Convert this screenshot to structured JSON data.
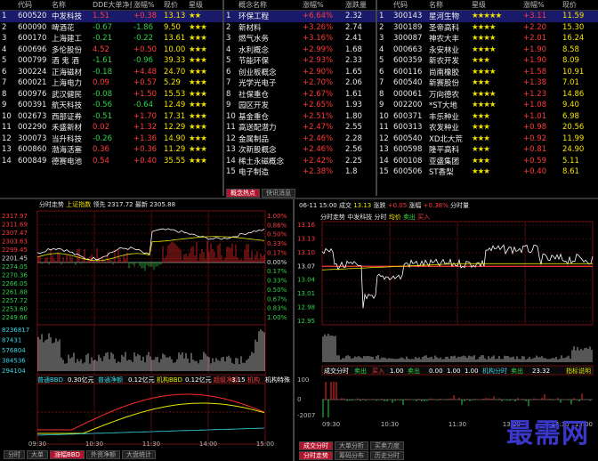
{
  "left_table": {
    "headers": [
      "代码",
      "名称",
      "DDE大单净量",
      "涨幅%",
      "现价",
      "星级"
    ],
    "rows": [
      {
        "idx": "1",
        "code": "600520",
        "name": "中发科技",
        "dde": "1.51",
        "chg": "+0.38",
        "price": "13.13",
        "stars": "★★",
        "sel": true
      },
      {
        "idx": "2",
        "code": "600090",
        "name": "啤酒花",
        "dde": "-0.67",
        "chg": "-1.86",
        "price": "9.50",
        "stars": "★★★"
      },
      {
        "idx": "3",
        "code": "600170",
        "name": "上海建工",
        "dde": "-0.21",
        "chg": "-0.22",
        "price": "13.61",
        "stars": "★★★"
      },
      {
        "idx": "4",
        "code": "600696",
        "name": "多伦股份",
        "dde": "4.52",
        "chg": "+0.50",
        "price": "10.00",
        "stars": "★★★"
      },
      {
        "idx": "5",
        "code": "000799",
        "name": "酒 鬼 酒",
        "dde": "-1.61",
        "chg": "-0.96",
        "price": "39.33",
        "stars": "★★★"
      },
      {
        "idx": "6",
        "code": "300224",
        "name": "正海磁材",
        "dde": "-0.18",
        "chg": "+4.48",
        "price": "24.70",
        "stars": "★★★"
      },
      {
        "idx": "7",
        "code": "600021",
        "name": "上海电力",
        "dde": "0.09",
        "chg": "+0.57",
        "price": "5.29",
        "stars": "★★★"
      },
      {
        "idx": "8",
        "code": "600976",
        "name": "武汉健民",
        "dde": "-0.08",
        "chg": "+1.50",
        "price": "15.53",
        "stars": "★★★"
      },
      {
        "idx": "9",
        "code": "600391",
        "name": "航天科技",
        "dde": "-0.56",
        "chg": "-0.64",
        "price": "12.49",
        "stars": "★★★"
      },
      {
        "idx": "10",
        "code": "002673",
        "name": "西部证券",
        "dde": "-0.51",
        "chg": "+1.70",
        "price": "17.31",
        "stars": "★★★"
      },
      {
        "idx": "11",
        "code": "002290",
        "name": "禾盛新材",
        "dde": "0.02",
        "chg": "+1.32",
        "price": "12.29",
        "stars": "★★★"
      },
      {
        "idx": "12",
        "code": "300073",
        "name": "当升科技",
        "dde": "-0.26",
        "chg": "+1.36",
        "price": "14.90",
        "stars": "★★★"
      },
      {
        "idx": "13",
        "code": "600860",
        "name": "渤海活塞",
        "dde": "0.36",
        "chg": "+0.36",
        "price": "11.29",
        "stars": "★★★"
      },
      {
        "idx": "14",
        "code": "600849",
        "name": "德赛电池",
        "dde": "0.54",
        "chg": "+0.40",
        "price": "35.55",
        "stars": "★★★"
      }
    ]
  },
  "concept_table": {
    "headers": [
      "",
      "概念名称",
      "涨幅%",
      "涨跌量"
    ],
    "rows": [
      {
        "idx": "1",
        "name": "环保工程",
        "chg": "+6.64%",
        "vol": "2.32",
        "sel": true
      },
      {
        "idx": "2",
        "name": "新材料",
        "chg": "+3.26%",
        "vol": "2.74"
      },
      {
        "idx": "3",
        "name": "燃气水务",
        "chg": "+3.16%",
        "vol": "2.41"
      },
      {
        "idx": "4",
        "name": "水利概念",
        "chg": "+2.99%",
        "vol": "1.68"
      },
      {
        "idx": "5",
        "name": "节能环保",
        "chg": "+2.93%",
        "vol": "2.33"
      },
      {
        "idx": "6",
        "name": "创业板概念",
        "chg": "+2.90%",
        "vol": "1.65"
      },
      {
        "idx": "7",
        "name": "光学光电子",
        "chg": "+2.70%",
        "vol": "2.06"
      },
      {
        "idx": "8",
        "name": "社保重仓",
        "chg": "+2.67%",
        "vol": "1.61"
      },
      {
        "idx": "9",
        "name": "园区开发",
        "chg": "+2.65%",
        "vol": "1.93"
      },
      {
        "idx": "10",
        "name": "基金重仓",
        "chg": "+2.51%",
        "vol": "1.80"
      },
      {
        "idx": "11",
        "name": "高送配潜力",
        "chg": "+2.47%",
        "vol": "2.55"
      },
      {
        "idx": "12",
        "name": "金属制品",
        "chg": "+2.46%",
        "vol": "2.28"
      },
      {
        "idx": "13",
        "name": "次新股概念",
        "chg": "+2.46%",
        "vol": "2.56"
      },
      {
        "idx": "14",
        "name": "稀土永磁概念",
        "chg": "+2.42%",
        "vol": "2.25"
      },
      {
        "idx": "15",
        "name": "电子制造",
        "chg": "+2.38%",
        "vol": "1.8"
      }
    ]
  },
  "right_table": {
    "headers": [
      "代码",
      "名称",
      "星级",
      "涨幅%",
      "现价"
    ],
    "rows": [
      {
        "idx": "1",
        "code": "300143",
        "name": "星河生物",
        "stars": "★★★★★",
        "chg": "+3.11",
        "price": "11.59",
        "sel": true
      },
      {
        "idx": "2",
        "code": "300189",
        "name": "圣帝高科",
        "stars": "★★★★",
        "chg": "+2.20",
        "price": "15.30"
      },
      {
        "idx": "3",
        "code": "300087",
        "name": "神农大丰",
        "stars": "★★★★",
        "chg": "+2.01",
        "price": "16.24"
      },
      {
        "idx": "4",
        "code": "000663",
        "name": "永安林业",
        "stars": "★★★★",
        "chg": "+1.90",
        "price": "8.58"
      },
      {
        "idx": "5",
        "code": "600359",
        "name": "新农开发",
        "stars": "★★★",
        "chg": "+1.90",
        "price": "8.09"
      },
      {
        "idx": "6",
        "code": "600116",
        "name": "尚南橡胶",
        "stars": "★★★★",
        "chg": "+1.58",
        "price": "10.91"
      },
      {
        "idx": "7",
        "code": "600540",
        "name": "新赛股份",
        "stars": "★★★",
        "chg": "+1.38",
        "price": "7.01"
      },
      {
        "idx": "8",
        "code": "000061",
        "name": "万向德农",
        "stars": "★★★★",
        "chg": "+1.23",
        "price": "14.86"
      },
      {
        "idx": "9",
        "code": "002200",
        "name": "*ST大地",
        "stars": "★★★★",
        "chg": "+1.08",
        "price": "9.40"
      },
      {
        "idx": "10",
        "code": "600371",
        "name": "丰乐种业",
        "stars": "★★★",
        "chg": "+1.01",
        "price": "6.98"
      },
      {
        "idx": "11",
        "code": "600313",
        "name": "农发种业",
        "stars": "★★★",
        "chg": "+0.98",
        "price": "20.56"
      },
      {
        "idx": "12",
        "code": "600540",
        "name": "XD北大荒",
        "stars": "★★★",
        "chg": "+0.92",
        "price": "11.99"
      },
      {
        "idx": "13",
        "code": "600598",
        "name": "隆平高科",
        "stars": "★★★",
        "chg": "+0.81",
        "price": "24.90"
      },
      {
        "idx": "14",
        "code": "600108",
        "name": "亚盛集团",
        "stars": "★★★",
        "chg": "+0.59",
        "price": "5.11"
      },
      {
        "idx": "15",
        "code": "600506",
        "name": "ST香梨",
        "stars": "★★★",
        "chg": "+0.40",
        "price": "8.61"
      }
    ]
  },
  "concept_tabs": [
    "概念热点",
    "快讯消息"
  ],
  "index_chart": {
    "header": [
      "分时走势",
      "上证指数",
      "领先 2317.72",
      "最新 2305.88"
    ],
    "price_ticks": [
      "2317.97",
      "2311.69",
      "2307.47",
      "2303.63",
      "2299.45",
      "2201.45",
      "2274.05",
      "2270.36",
      "2266.05",
      "2261.88",
      "2257.72",
      "2253.60",
      "2249.66"
    ],
    "pct_ticks": [
      "1.00%",
      "0.86%",
      "0.50%",
      "0.33%",
      "0.17%",
      "0.00%",
      "0.17%",
      "0.33%",
      "0.50%",
      "0.67%",
      "0.83%",
      "1.00%"
    ],
    "vol_ticks": [
      "8236817",
      "87431",
      "576804",
      "384536",
      "294104"
    ],
    "bbd_header": [
      "普通BBD",
      "0.30亿元",
      "普通净额",
      "0.12亿元",
      "机构BBD",
      "0.12亿元",
      "超级净额",
      "3.15",
      "机构",
      "机构特殊"
    ],
    "time_ticks": [
      "09:30",
      "10:30",
      "11:30",
      "14:00",
      "15:00"
    ]
  },
  "index_tabs": [
    "分时",
    "大单",
    "涨幅BBD",
    "外资净额",
    "大盘统计"
  ],
  "stock_chart": {
    "header": [
      "06-11 15:00",
      "成交",
      "13.13",
      "涨跌",
      "+0.05",
      "涨幅",
      "+0.38%",
      "分时量"
    ],
    "sub_header": [
      "分时走势",
      "中发科技",
      "分时",
      "均价",
      "卖出",
      "买入"
    ],
    "price_ticks": [
      "13.16",
      "13.13",
      "13.10",
      "13.07",
      "13.04",
      "13.01",
      "12.98",
      "12.95"
    ],
    "vol_header": [
      "成交分时",
      "卖出",
      "买入",
      "1.00",
      "卖出",
      "0.00",
      "1.00",
      "1.00",
      "机构分时",
      "卖出",
      "23.32"
    ],
    "vol_ticks": [
      "100",
      "0",
      "-2007"
    ],
    "time_ticks": [
      "09:30",
      "10:30",
      "11:30",
      "13:30",
      "14:30",
      "15:00"
    ],
    "indicator_label": "指标说明"
  },
  "stock_tabs": [
    "成交分时",
    "大单分析",
    "买卖力度",
    "分时走势",
    "筹码分布",
    "历史分时"
  ],
  "watermark": "最需网",
  "colors": {
    "up": "#ff3b3b",
    "down": "#2fd24a",
    "price": "#f2e200",
    "bg": "#000000",
    "sel": "#1a1a6a"
  }
}
